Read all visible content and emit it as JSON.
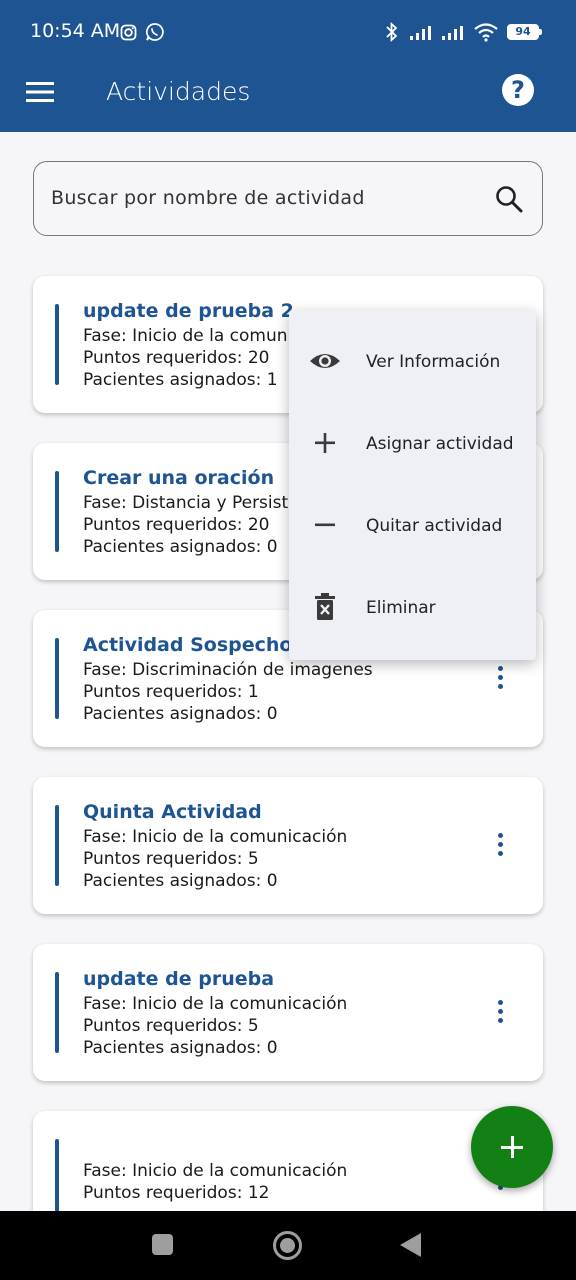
{
  "status_bar": {
    "time": "10:54 AM",
    "battery": "94",
    "icons": [
      "instagram-icon",
      "whatsapp-icon",
      "bluetooth-icon",
      "signal-icon",
      "signal-icon",
      "wifi-icon",
      "battery-icon"
    ]
  },
  "app_bar": {
    "title": "Actividades",
    "menu_icon": "menu-icon",
    "help_icon": "help-icon",
    "help_glyph": "?"
  },
  "search": {
    "placeholder": "Buscar por nombre de actividad",
    "icon": "search-icon"
  },
  "activities": [
    {
      "title": "update de prueba 2",
      "phase": "Fase: Inicio de la comunicación",
      "points": "Puntos requeridos: 20",
      "patients": "Pacientes asignados: 1"
    },
    {
      "title": "Crear una oración",
      "phase": "Fase: Distancia y Persistencia",
      "points": "Puntos requeridos: 20",
      "patients": "Pacientes asignados: 0"
    },
    {
      "title": "Actividad Sospechosa",
      "phase": "Fase: Discriminación de imagenes",
      "points": "Puntos requeridos: 1",
      "patients": "Pacientes asignados: 0"
    },
    {
      "title": "Quinta Actividad",
      "phase": "Fase: Inicio de la comunicación",
      "points": "Puntos requeridos: 5",
      "patients": "Pacientes asignados: 0"
    },
    {
      "title": "update de prueba",
      "phase": "Fase: Inicio de la comunicación",
      "points": "Puntos requeridos: 5",
      "patients": "Pacientes asignados: 0"
    },
    {
      "title": "",
      "phase": "Fase: Inicio de la comunicación",
      "points": "Puntos requeridos: 12",
      "patients": ""
    }
  ],
  "context_menu": {
    "items": [
      {
        "label": "Ver Información",
        "icon": "eye-icon"
      },
      {
        "label": "Asignar actividad",
        "icon": "plus-icon"
      },
      {
        "label": "Quitar actividad",
        "icon": "minus-icon"
      },
      {
        "label": "Eliminar",
        "icon": "trash-icon"
      }
    ]
  },
  "fab": {
    "icon": "plus-icon"
  },
  "nav_bar": {
    "icons": [
      "recents-icon",
      "home-icon",
      "back-icon"
    ]
  },
  "colors": {
    "primary": "#1f5493",
    "fab": "#138016",
    "background": "#f6f6f9",
    "menu_bg": "#eff0f6"
  }
}
